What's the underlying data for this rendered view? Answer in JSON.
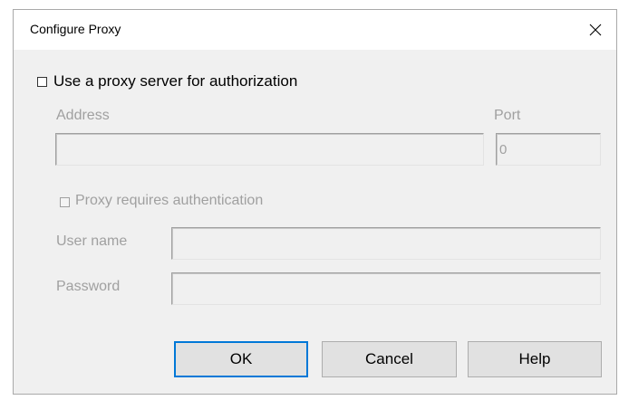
{
  "window": {
    "title": "Configure Proxy",
    "close_icon": "close-icon"
  },
  "proxy": {
    "use_proxy_label": "Use a proxy server for authorization",
    "use_proxy_checked": false,
    "address_label": "Address",
    "address_value": "",
    "port_label": "Port",
    "port_value": "0"
  },
  "auth": {
    "requires_auth_label": "Proxy requires authentication",
    "requires_auth_checked": false,
    "username_label": "User name",
    "username_value": "",
    "password_label": "Password",
    "password_value": ""
  },
  "buttons": {
    "ok": "OK",
    "cancel": "Cancel",
    "help": "Help"
  },
  "colors": {
    "dialog_bg": "#f0f0f0",
    "disabled_text": "#a0a0a0",
    "default_button_border": "#0078d7"
  }
}
